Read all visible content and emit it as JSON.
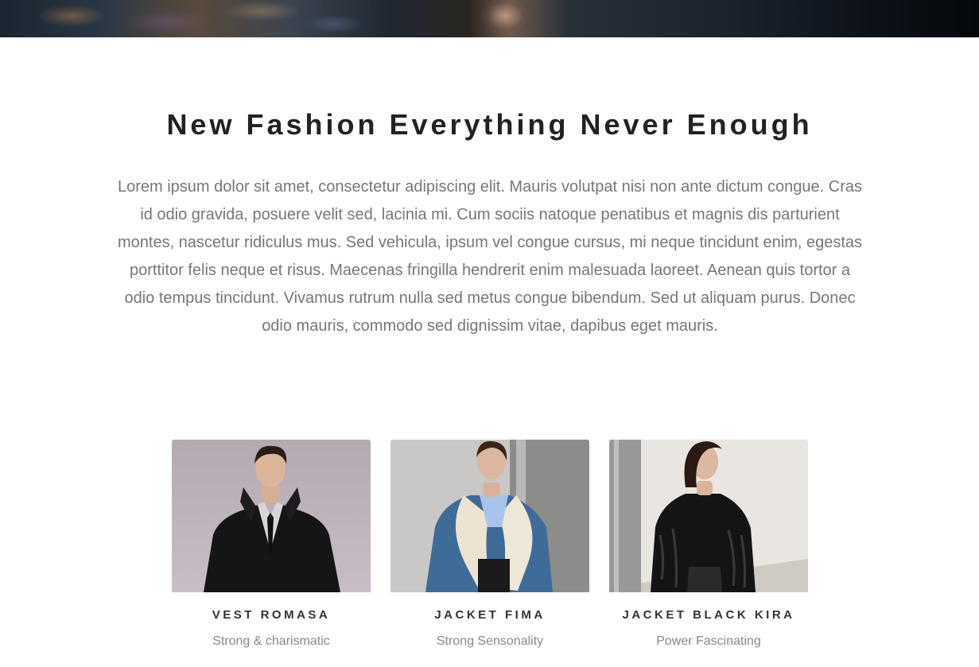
{
  "section": {
    "title": "New Fashion Everything Never Enough",
    "body": "Lorem ipsum dolor sit amet, consectetur adipiscing elit. Mauris volutpat nisi non ante dictum congue. Cras id odio gravida, posuere velit sed, lacinia mi. Cum sociis natoque penatibus et magnis dis parturient montes, nascetur ridiculus mus. Sed vehicula, ipsum vel congue cursus, mi neque tincidunt enim, egestas porttitor felis neque et risus. Maecenas fringilla hendrerit enim malesuada laoreet. Aenean quis tortor a odio tempus tincidunt. Vivamus rutrum nulla sed metus congue bibendum. Sed ut aliquam purus. Donec odio mauris, commodo sed dignissim vitae, dapibus eget mauris."
  },
  "products": [
    {
      "name": "VEST ROMASA",
      "tagline": "Strong & charismatic"
    },
    {
      "name": "JACKET FIMA",
      "tagline": "Strong Sensonality"
    },
    {
      "name": "JACKET BLACK KIRA",
      "tagline": "Power Fascinating"
    }
  ],
  "colors": {
    "title": "#222222",
    "body_text": "#777777",
    "product_name": "#333333",
    "tagline": "#888888"
  }
}
